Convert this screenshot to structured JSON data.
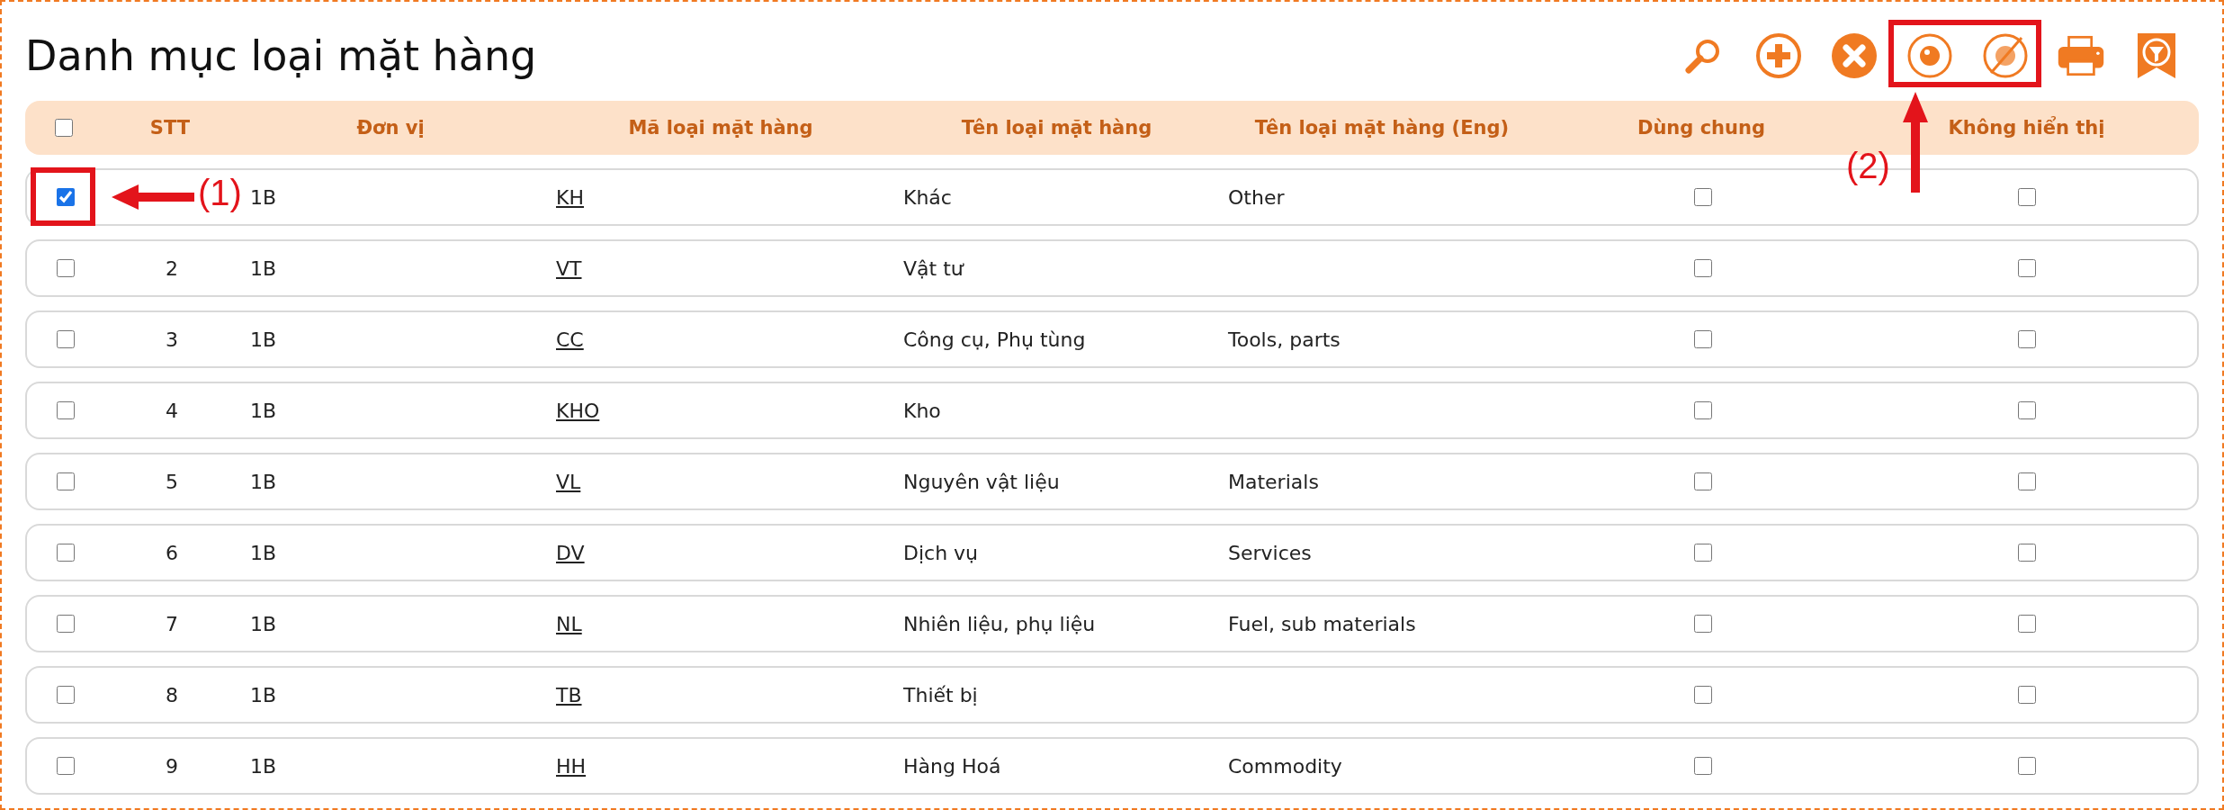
{
  "title": "Danh mục loại mặt hàng",
  "toolbar": [
    {
      "kind": "search"
    },
    {
      "kind": "add"
    },
    {
      "kind": "delete"
    },
    {
      "kind": "show"
    },
    {
      "kind": "hide"
    },
    {
      "kind": "print"
    },
    {
      "kind": "filter"
    }
  ],
  "table": {
    "select_all": {
      "checked": false
    },
    "columns": [
      "STT",
      "Đơn vị",
      "Mã loại mặt hàng",
      "Tên loại mặt hàng",
      "Tên loại mặt hàng (Eng)",
      "Dùng chung",
      "Không hiển thị"
    ],
    "rows": [
      {
        "checked": true,
        "unit": "1B",
        "code": "KH",
        "name": "Khác",
        "name_eng": "Other",
        "shared": false,
        "hidden": false
      },
      {
        "checked": false,
        "stt": "2",
        "unit": "1B",
        "code": "VT",
        "name": "Vật tư",
        "shared": false,
        "hidden": false
      },
      {
        "checked": false,
        "stt": "3",
        "unit": "1B",
        "code": "CC",
        "name": "Công cụ, Phụ tùng",
        "name_eng": "Tools, parts",
        "shared": false,
        "hidden": false
      },
      {
        "checked": false,
        "stt": "4",
        "unit": "1B",
        "code": "KHO",
        "name": "Kho",
        "shared": false,
        "hidden": false
      },
      {
        "checked": false,
        "stt": "5",
        "unit": "1B",
        "code": "VL",
        "name": "Nguyên vật liệu",
        "name_eng": "Materials",
        "shared": false,
        "hidden": false
      },
      {
        "checked": false,
        "stt": "6",
        "unit": "1B",
        "code": "DV",
        "name": "Dịch vụ",
        "name_eng": "Services",
        "shared": false,
        "hidden": false
      },
      {
        "checked": false,
        "stt": "7",
        "unit": "1B",
        "code": "NL",
        "name": "Nhiên liệu, phụ liệu",
        "name_eng": "Fuel, sub materials",
        "shared": false,
        "hidden": false
      },
      {
        "checked": false,
        "stt": "8",
        "unit": "1B",
        "code": "TB",
        "name": "Thiết bị",
        "shared": false,
        "hidden": false
      },
      {
        "checked": false,
        "stt": "9",
        "unit": "1B",
        "code": "HH",
        "name": "Hàng Hoá",
        "name_eng": "Commodity",
        "shared": false,
        "hidden": false
      }
    ]
  },
  "annotations": [
    {
      "label": "(1)"
    },
    {
      "label": "(2)"
    }
  ]
}
